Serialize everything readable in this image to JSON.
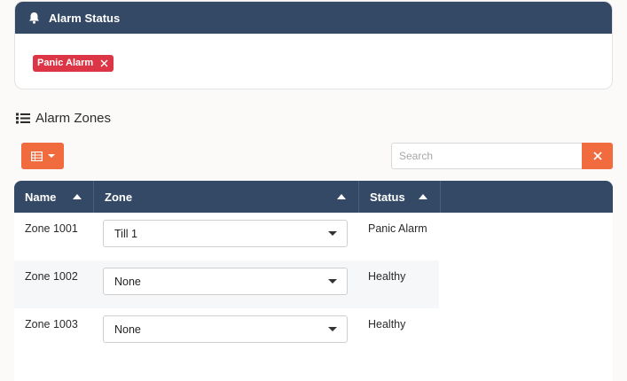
{
  "alarm_status": {
    "title": "Alarm Status",
    "icon": "bell-icon",
    "tags": [
      {
        "label": "Panic Alarm",
        "color": "#dc3545"
      }
    ]
  },
  "zones_section": {
    "title": "Alarm Zones",
    "icon": "list-icon"
  },
  "toolbar": {
    "grid_icon": "table-icon",
    "search_placeholder": "Search",
    "accent": "#f06b3e"
  },
  "table": {
    "header_color": "#344966",
    "columns": [
      "Name",
      "Zone",
      "Status"
    ],
    "rows": [
      {
        "name": "Zone 1001",
        "zone": "Till 1",
        "status": "Panic Alarm"
      },
      {
        "name": "Zone 1002",
        "zone": "None",
        "status": "Healthy"
      },
      {
        "name": "Zone 1003",
        "zone": "None",
        "status": "Healthy"
      }
    ]
  }
}
